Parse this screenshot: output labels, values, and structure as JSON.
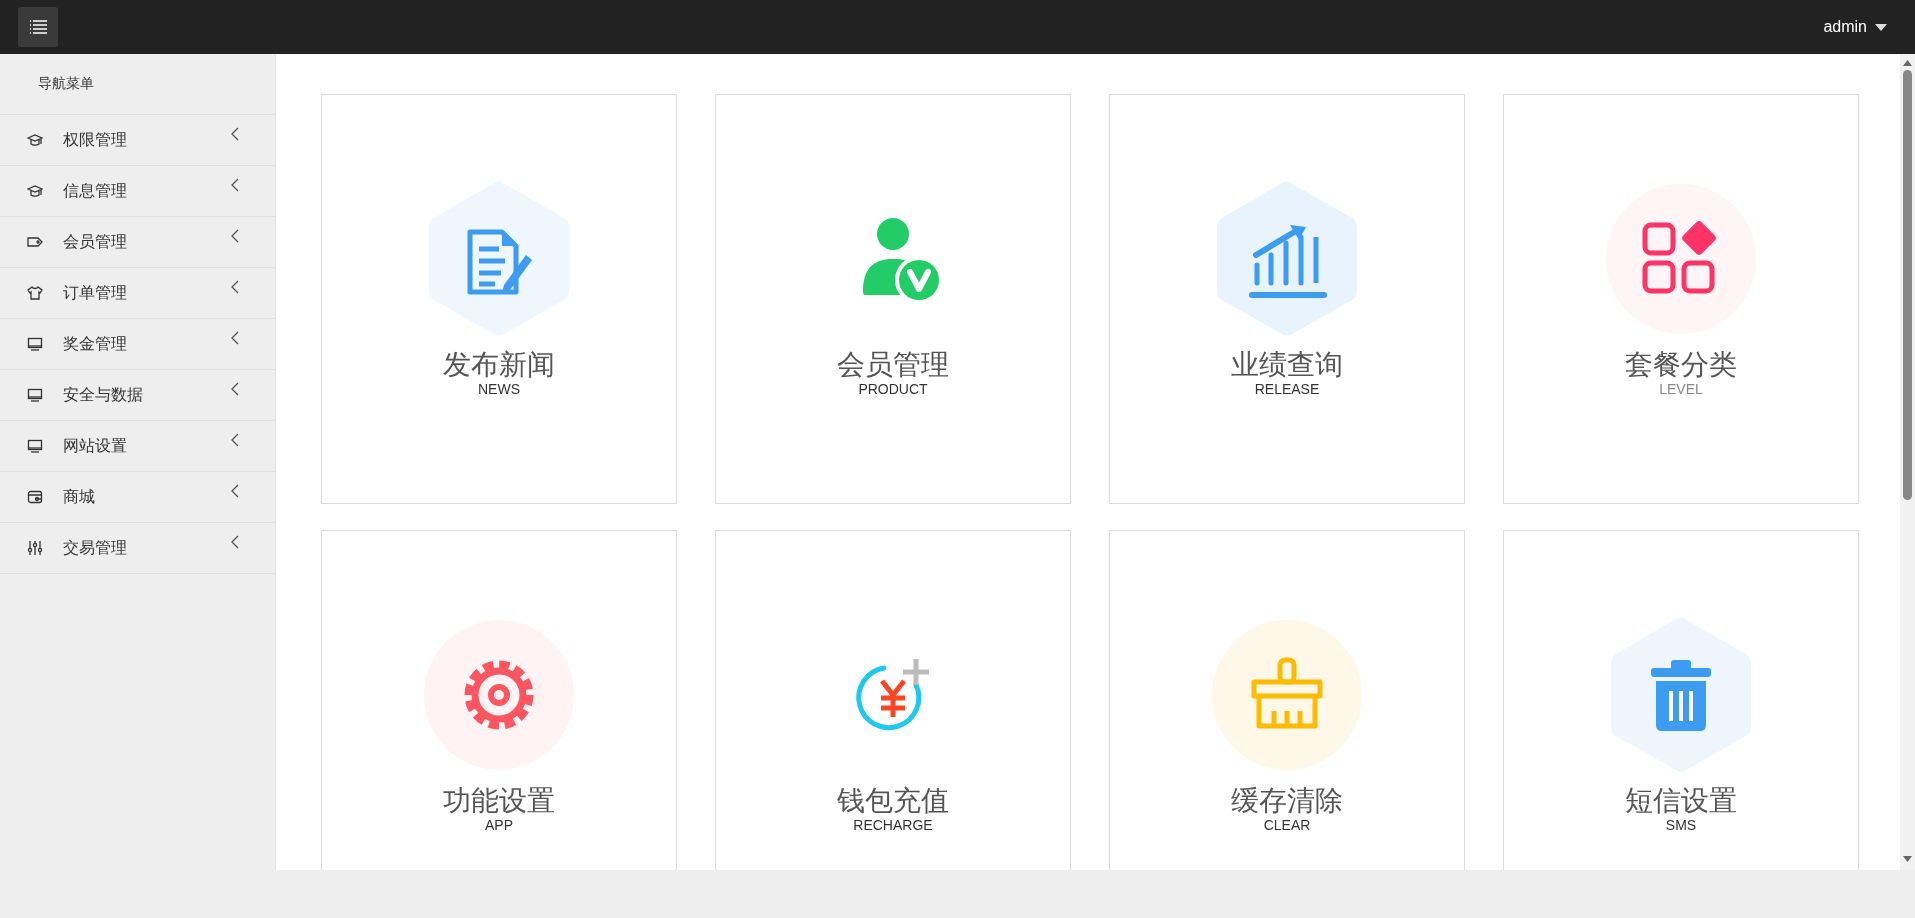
{
  "topbar": {
    "user": "admin"
  },
  "sidebar": {
    "heading": "导航菜单",
    "items": [
      {
        "label": "权限管理"
      },
      {
        "label": "信息管理"
      },
      {
        "label": "会员管理"
      },
      {
        "label": "订单管理"
      },
      {
        "label": "奖金管理"
      },
      {
        "label": "安全与数据"
      },
      {
        "label": "网站设置"
      },
      {
        "label": "商城"
      },
      {
        "label": "交易管理"
      }
    ]
  },
  "cards": [
    {
      "title": "发布新闻",
      "subtitle": "NEWS"
    },
    {
      "title": "会员管理",
      "subtitle": "PRODUCT"
    },
    {
      "title": "业绩查询",
      "subtitle": "RELEASE"
    },
    {
      "title": "套餐分类",
      "subtitle": "LEVEL"
    },
    {
      "title": "功能设置",
      "subtitle": "APP"
    },
    {
      "title": "钱包充值",
      "subtitle": "RECHARGE"
    },
    {
      "title": "缓存清除",
      "subtitle": "CLEAR"
    },
    {
      "title": "短信设置",
      "subtitle": "SMS"
    }
  ]
}
